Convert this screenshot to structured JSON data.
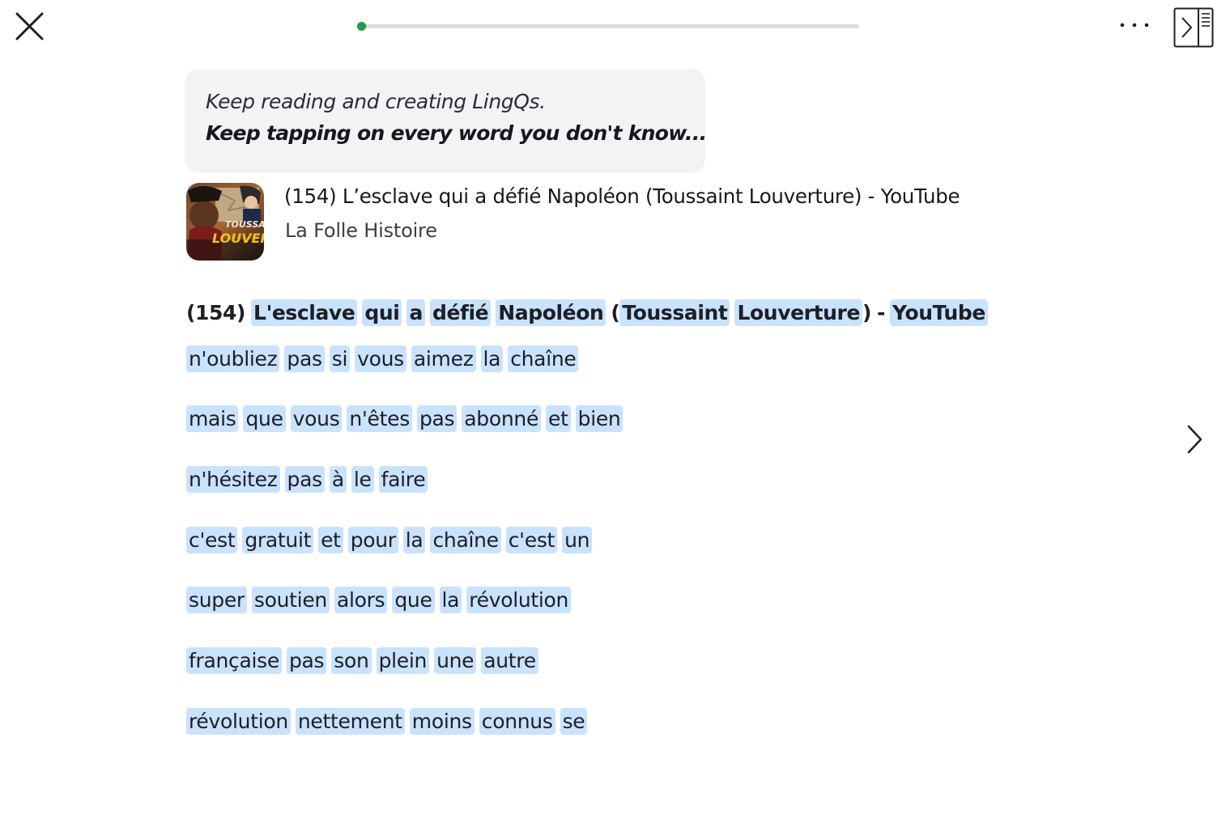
{
  "topbar": {
    "close_icon": "close-icon",
    "progress_fraction": 0.02,
    "progress_color": "#1f9c4d",
    "more_icon": "more-dots-icon",
    "sidebar_icon": "sidebar-toggle-icon"
  },
  "tip": {
    "line1": "Keep reading and creating LingQs.",
    "line2": "Keep tapping on every word you don't know..."
  },
  "lesson": {
    "title": "(154) L’esclave qui a défié Napoléon (Toussaint Louverture) - YouTube",
    "source": "La Folle Histoire",
    "thumbnail_text_top": "TOUSSAINT",
    "thumbnail_text_bottom": "LOUVERTU"
  },
  "reader": {
    "heading": {
      "prefix": "(154)",
      "words1": [
        "L'esclave",
        "qui",
        "a",
        "défié",
        "Napoléon"
      ],
      "open_paren": "(",
      "words2": [
        "Toussaint",
        "Louverture"
      ],
      "close_paren_dash": ")",
      "dash": "-",
      "words3": [
        "YouTube"
      ]
    },
    "lines": [
      [
        "n'oubliez",
        "pas",
        "si",
        "vous",
        "aimez",
        "la",
        "chaîne"
      ],
      [
        "mais",
        "que",
        "vous",
        "n'êtes",
        "pas",
        "abonné",
        "et",
        "bien"
      ],
      [
        "n'hésitez",
        "pas",
        "à",
        "le",
        "faire"
      ],
      [
        "c'est",
        "gratuit",
        "et",
        "pour",
        "la",
        "chaîne",
        "c'est",
        "un"
      ],
      [
        "super",
        "soutien",
        "alors",
        "que",
        "la",
        "révolution"
      ],
      [
        "française",
        "pas",
        "son",
        "plein",
        "une",
        "autre"
      ],
      [
        "révolution",
        "nettement",
        "moins",
        "connus",
        "se"
      ]
    ],
    "highlight_color": "#c9e2fd"
  },
  "nav": {
    "next_icon": "chevron-right-icon"
  }
}
